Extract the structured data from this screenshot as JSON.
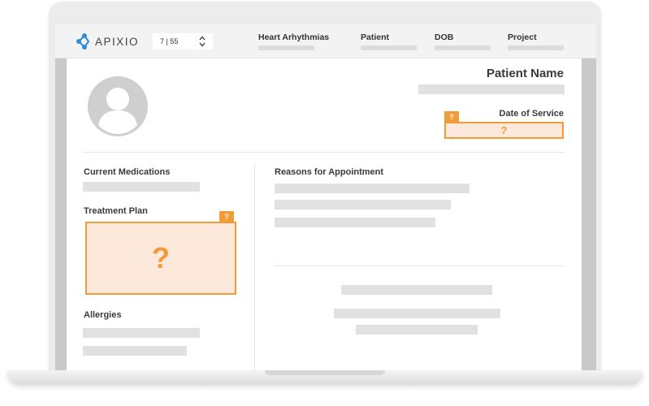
{
  "app": {
    "logo_text": "APIXIO"
  },
  "pager": {
    "text": "7 | 55"
  },
  "header": {
    "columns": [
      {
        "label": "Heart Arhythmias"
      },
      {
        "label": "Patient"
      },
      {
        "label": "DOB"
      },
      {
        "label": "Project"
      }
    ]
  },
  "patient": {
    "name_label": "Patient Name"
  },
  "date_of_service": {
    "label": "Date of Service",
    "tag": "?",
    "value": "?"
  },
  "left": {
    "medications_label": "Current Medications",
    "treatment_label": "Treatment Plan",
    "treatment_tag": "?",
    "treatment_value": "?",
    "allergies_label": "Allergies"
  },
  "right": {
    "reasons_label": "Reasons for Appointment"
  },
  "colors": {
    "accent": "#f29c38",
    "highlight_fill": "#fde9dc",
    "placeholder_bar": "#e1e1e1",
    "logo_blue": "#2a8fd8"
  }
}
